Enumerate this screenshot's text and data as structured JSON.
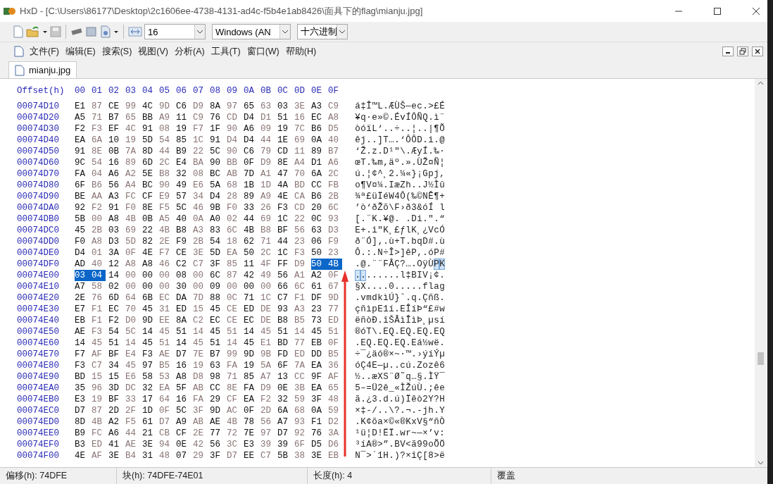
{
  "window": {
    "title": "HxD - [C:\\Users\\86177\\Desktop\\2c1606ee-4738-4131-ad4c-f5b4e1ab8426\\面具下的flag\\mianju.jpg]"
  },
  "toolbar": {
    "bytes_per_row": "16",
    "charset": "Windows (AN",
    "display": "十六进制"
  },
  "menu": [
    "文件(F)",
    "编辑(E)",
    "搜索(S)",
    "视图(V)",
    "分析(A)",
    "工具(T)",
    "窗口(W)",
    "帮助(H)"
  ],
  "tabs": [
    {
      "label": "mianju.jpg",
      "selected": true
    }
  ],
  "editor": {
    "offset_header": "Offset(h)",
    "column_headers": [
      "00",
      "01",
      "02",
      "03",
      "04",
      "05",
      "06",
      "07",
      "08",
      "09",
      "0A",
      "0B",
      "0C",
      "0D",
      "0E",
      "0F"
    ],
    "rows": [
      {
        "offset": "00074D10",
        "bytes": [
          "E1",
          "87",
          "CE",
          "99",
          "4C",
          "9D",
          "C6",
          "D9",
          "8A",
          "97",
          "65",
          "63",
          "03",
          "3E",
          "A3",
          "C9"
        ],
        "ascii": "á‡Î™L.ÆÙŠ—ec.>£É"
      },
      {
        "offset": "00074D20",
        "bytes": [
          "A5",
          "71",
          "B7",
          "65",
          "BB",
          "A9",
          "11",
          "C9",
          "76",
          "CD",
          "D4",
          "D1",
          "51",
          "16",
          "EC",
          "A8"
        ],
        "ascii": "¥q·e»©.ÉvÍÔÑQ.ì¨"
      },
      {
        "offset": "00074D30",
        "bytes": [
          "F2",
          "F3",
          "EF",
          "4C",
          "91",
          "08",
          "19",
          "F7",
          "1F",
          "90",
          "A6",
          "09",
          "19",
          "7C",
          "B6",
          "D5"
        ],
        "ascii": "òóïL‘..÷..¦..|¶Õ"
      },
      {
        "offset": "00074D40",
        "bytes": [
          "EA",
          "6A",
          "10",
          "19",
          "5D",
          "54",
          "85",
          "1C",
          "91",
          "D4",
          "D4",
          "44",
          "1E",
          "69",
          "0A",
          "40"
        ],
        "ascii": "êj..]T….‘ÔÔD.i.@"
      },
      {
        "offset": "00074D50",
        "bytes": [
          "91",
          "8E",
          "0B",
          "7A",
          "8D",
          "44",
          "B9",
          "22",
          "5C",
          "90",
          "C6",
          "79",
          "CD",
          "11",
          "89",
          "B7"
        ],
        "ascii": "‘Ž.z.D¹\"\\.ÆyÍ.‰·"
      },
      {
        "offset": "00074D60",
        "bytes": [
          "9C",
          "54",
          "16",
          "89",
          "6D",
          "2C",
          "E4",
          "BA",
          "90",
          "BB",
          "0F",
          "D9",
          "8E",
          "A4",
          "D1",
          "A6"
        ],
        "ascii": "œT.‰m,äº.».ÙŽ¤Ñ¦"
      },
      {
        "offset": "00074D70",
        "bytes": [
          "FA",
          "04",
          "A6",
          "A2",
          "5E",
          "B8",
          "32",
          "08",
          "BC",
          "AB",
          "7D",
          "A1",
          "47",
          "70",
          "6A",
          "2C"
        ],
        "ascii": "ú.¦¢^¸2.¼«}¡Gpj,"
      },
      {
        "offset": "00074D80",
        "bytes": [
          "6F",
          "B6",
          "56",
          "A4",
          "BC",
          "90",
          "49",
          "E6",
          "5A",
          "68",
          "1B",
          "1D",
          "4A",
          "BD",
          "CC",
          "FB"
        ],
        "ascii": "o¶V¤¼.IæZh..J½Ìû"
      },
      {
        "offset": "00074D90",
        "bytes": [
          "BE",
          "AA",
          "A3",
          "FC",
          "CF",
          "E9",
          "57",
          "34",
          "D4",
          "28",
          "89",
          "A9",
          "4E",
          "CA",
          "B6",
          "2B"
        ],
        "ascii": "¾ª£üÏéW4Ô(‰©NÊ¶+"
      },
      {
        "offset": "00074DA0",
        "bytes": [
          "92",
          "F2",
          "91",
          "F0",
          "8E",
          "F5",
          "5C",
          "46",
          "9B",
          "F0",
          "33",
          "26",
          "F3",
          "CD",
          "20",
          "6C"
        ],
        "ascii": "’ò‘ðŽõ\\F›ð3&óÍ l"
      },
      {
        "offset": "00074DB0",
        "bytes": [
          "5B",
          "00",
          "A8",
          "4B",
          "0B",
          "A5",
          "40",
          "0A",
          "A0",
          "02",
          "44",
          "69",
          "1C",
          "22",
          "0C",
          "93"
        ],
        "ascii": "[.¨K.¥@. .Di.\".“"
      },
      {
        "offset": "00074DC0",
        "bytes": [
          "45",
          "2B",
          "03",
          "69",
          "22",
          "4B",
          "B8",
          "A3",
          "83",
          "6C",
          "4B",
          "B8",
          "BF",
          "56",
          "63",
          "D3"
        ],
        "ascii": "E+.i\"K¸£ƒlK¸¿VcÓ"
      },
      {
        "offset": "00074DD0",
        "bytes": [
          "F0",
          "A8",
          "D3",
          "5D",
          "82",
          "2E",
          "F9",
          "2B",
          "54",
          "18",
          "62",
          "71",
          "44",
          "23",
          "06",
          "F9"
        ],
        "ascii": "ð¨Ó]‚.ù+T.bqD#.ù"
      },
      {
        "offset": "00074DE0",
        "bytes": [
          "D4",
          "01",
          "3A",
          "0F",
          "4E",
          "F7",
          "CE",
          "3E",
          "5D",
          "EA",
          "50",
          "2C",
          "1C",
          "F3",
          "50",
          "23"
        ],
        "ascii": "Ô.:.N÷Î>]êP,.óP#"
      },
      {
        "offset": "00074DF0",
        "bytes": [
          "AD",
          "40",
          "12",
          "A8",
          "A8",
          "46",
          "C2",
          "C7",
          "3F",
          "85",
          "11",
          "4F",
          "FF",
          "D9",
          "50",
          "4B"
        ],
        "ascii": ".@.¨¨FÂÇ?….OÿÙPK",
        "selected": [
          false,
          false,
          false,
          false,
          false,
          false,
          false,
          false,
          false,
          false,
          false,
          false,
          false,
          false,
          true,
          true
        ]
      },
      {
        "offset": "00074E00",
        "bytes": [
          "03",
          "04",
          "14",
          "00",
          "00",
          "00",
          "08",
          "00",
          "6C",
          "87",
          "42",
          "49",
          "56",
          "A1",
          "A2",
          "0F"
        ],
        "ascii": "........l‡BIV¡¢.",
        "selected": [
          true,
          true,
          false,
          false,
          false,
          false,
          false,
          false,
          false,
          false,
          false,
          false,
          false,
          false,
          false,
          false
        ]
      },
      {
        "offset": "00074E10",
        "bytes": [
          "A7",
          "58",
          "02",
          "00",
          "00",
          "00",
          "30",
          "00",
          "09",
          "00",
          "00",
          "00",
          "66",
          "6C",
          "61",
          "67"
        ],
        "ascii": "§X....0.....flag"
      },
      {
        "offset": "00074E20",
        "bytes": [
          "2E",
          "76",
          "6D",
          "64",
          "6B",
          "EC",
          "DA",
          "7D",
          "88",
          "0C",
          "71",
          "1C",
          "C7",
          "F1",
          "DF",
          "9D"
        ],
        "ascii": ".vmdkìÚ}ˆ.q.Çñß."
      },
      {
        "offset": "00074E30",
        "bytes": [
          "E7",
          "F1",
          "EC",
          "70",
          "45",
          "31",
          "ED",
          "15",
          "45",
          "CE",
          "ED",
          "DE",
          "93",
          "A3",
          "23",
          "77"
        ],
        "ascii": "çñìpE1í.EÎíÞ“£#w"
      },
      {
        "offset": "00074E40",
        "bytes": [
          "EB",
          "F1",
          "F2",
          "D0",
          "9D",
          "EE",
          "8A",
          "C2",
          "EC",
          "CE",
          "EC",
          "DE",
          "B8",
          "B5",
          "73",
          "ED"
        ],
        "ascii": "ëñòÐ.îŠÂìÎìÞ¸µsí"
      },
      {
        "offset": "00074E50",
        "bytes": [
          "AE",
          "F3",
          "54",
          "5C",
          "14",
          "45",
          "51",
          "14",
          "45",
          "51",
          "14",
          "45",
          "51",
          "14",
          "45",
          "51"
        ],
        "ascii": "®óT\\.EQ.EQ.EQ.EQ"
      },
      {
        "offset": "00074E60",
        "bytes": [
          "14",
          "45",
          "51",
          "14",
          "45",
          "51",
          "14",
          "45",
          "51",
          "14",
          "45",
          "E1",
          "BD",
          "77",
          "EB",
          "0F"
        ],
        "ascii": ".EQ.EQ.EQ.Eá½wë."
      },
      {
        "offset": "00074E70",
        "bytes": [
          "F7",
          "AF",
          "BF",
          "E4",
          "F3",
          "AE",
          "D7",
          "7E",
          "B7",
          "99",
          "9D",
          "9B",
          "FD",
          "ED",
          "DD",
          "B5"
        ],
        "ascii": "÷¯¿äó®×~·™.›ýíÝµ"
      },
      {
        "offset": "00074E80",
        "bytes": [
          "F3",
          "C7",
          "34",
          "45",
          "97",
          "B5",
          "16",
          "19",
          "63",
          "FA",
          "19",
          "5A",
          "6F",
          "7A",
          "EA",
          "36"
        ],
        "ascii": "óÇ4E—µ..cú.Zozê6"
      },
      {
        "offset": "00074E90",
        "bytes": [
          "BD",
          "15",
          "15",
          "E6",
          "58",
          "53",
          "A8",
          "D8",
          "98",
          "71",
          "85",
          "A7",
          "13",
          "CC",
          "9F",
          "AF"
        ],
        "ascii": "½..æXS¨Ø˜q…§.ÌŸ¯"
      },
      {
        "offset": "00074EA0",
        "bytes": [
          "35",
          "96",
          "3D",
          "DC",
          "32",
          "EA",
          "5F",
          "AB",
          "CC",
          "8E",
          "FA",
          "D9",
          "0E",
          "3B",
          "EA",
          "65"
        ],
        "ascii": "5–=Ü2ê_«ÌŽúÙ.;êe"
      },
      {
        "offset": "00074EB0",
        "bytes": [
          "E3",
          "19",
          "BF",
          "33",
          "17",
          "64",
          "16",
          "FA",
          "29",
          "CF",
          "EA",
          "F2",
          "32",
          "59",
          "3F",
          "48"
        ],
        "ascii": "ã.¿3.d.ú)Ïêò2Y?H"
      },
      {
        "offset": "00074EC0",
        "bytes": [
          "D7",
          "87",
          "2D",
          "2F",
          "1D",
          "0F",
          "5C",
          "3F",
          "9D",
          "AC",
          "0F",
          "2D",
          "6A",
          "68",
          "0A",
          "59"
        ],
        "ascii": "×‡-/..\\?.¬.-jh.Y"
      },
      {
        "offset": "00074ED0",
        "bytes": [
          "8D",
          "4B",
          "A2",
          "F5",
          "61",
          "D7",
          "A9",
          "AB",
          "AE",
          "4B",
          "78",
          "56",
          "A7",
          "93",
          "F1",
          "D2"
        ],
        "ascii": ".K¢õa×©«®KxV§“ñÒ"
      },
      {
        "offset": "00074EE0",
        "bytes": [
          "B9",
          "FC",
          "A6",
          "44",
          "21",
          "CB",
          "CF",
          "2E",
          "77",
          "72",
          "7E",
          "97",
          "D7",
          "92",
          "76",
          "3A"
        ],
        "ascii": "¹ü¦D!ËÏ.wr~—×’v:"
      },
      {
        "offset": "00074EF0",
        "bytes": [
          "B3",
          "ED",
          "41",
          "AE",
          "3E",
          "94",
          "0E",
          "42",
          "56",
          "3C",
          "E3",
          "39",
          "39",
          "6F",
          "D5",
          "D6"
        ],
        "ascii": "³íA®>”.BV<ã99oÕÖ"
      },
      {
        "offset": "00074F00",
        "bytes": [
          "4E",
          "AF",
          "3E",
          "B4",
          "31",
          "48",
          "07",
          "29",
          "3F",
          "D7",
          "EE",
          "C7",
          "5B",
          "38",
          "3E",
          "EB"
        ],
        "ascii": "N¯>´1H.)?×îÇ[8>ë"
      }
    ]
  },
  "status_bar": [
    "偏移(h): 74DFE",
    "块(h): 74DFE-74E01",
    "长度(h): 4",
    "覆盖"
  ]
}
